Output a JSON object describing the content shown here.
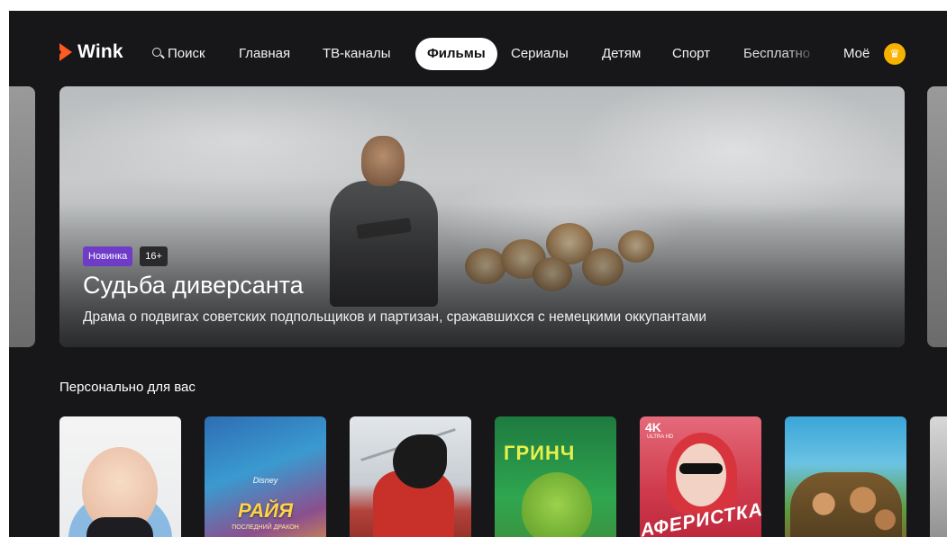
{
  "nav": {
    "logo": "Wink",
    "search": "Поиск",
    "items": [
      "Главная",
      "ТВ-каналы",
      "Фильмы",
      "Сериалы",
      "Детям",
      "Спорт",
      "Бесплатно",
      "Моё"
    ],
    "active": "Фильмы"
  },
  "hero": {
    "tag_new": "Новинка",
    "tag_age": "16+",
    "title": "Судьба диверсанта",
    "description": "Драма о подвигах советских подпольщиков и партизан, сражавшихся с немецкими оккупантами"
  },
  "section": {
    "title": "Персонально для вас"
  },
  "posters": [
    {
      "id": "boss-baby",
      "icon": "boss-baby-poster"
    },
    {
      "id": "raya",
      "label": "РАЙЯ",
      "subtitle": "ПОСЛЕДНИЙ ДРАКОН",
      "brand": "Disney"
    },
    {
      "id": "mulan",
      "icon": "mulan-poster"
    },
    {
      "id": "grinch",
      "label": "ГРИНЧ"
    },
    {
      "id": "aferistka",
      "label": "АФЕРИСТКА",
      "badge": "4K",
      "badge_sub": "ULTRA HD"
    },
    {
      "id": "croods",
      "icon": "croods-poster"
    }
  ],
  "colors": {
    "background": "#17171a",
    "accent": "#ff5a1f",
    "tag_new": "#6e3cc9",
    "crown": "#f5b300"
  }
}
